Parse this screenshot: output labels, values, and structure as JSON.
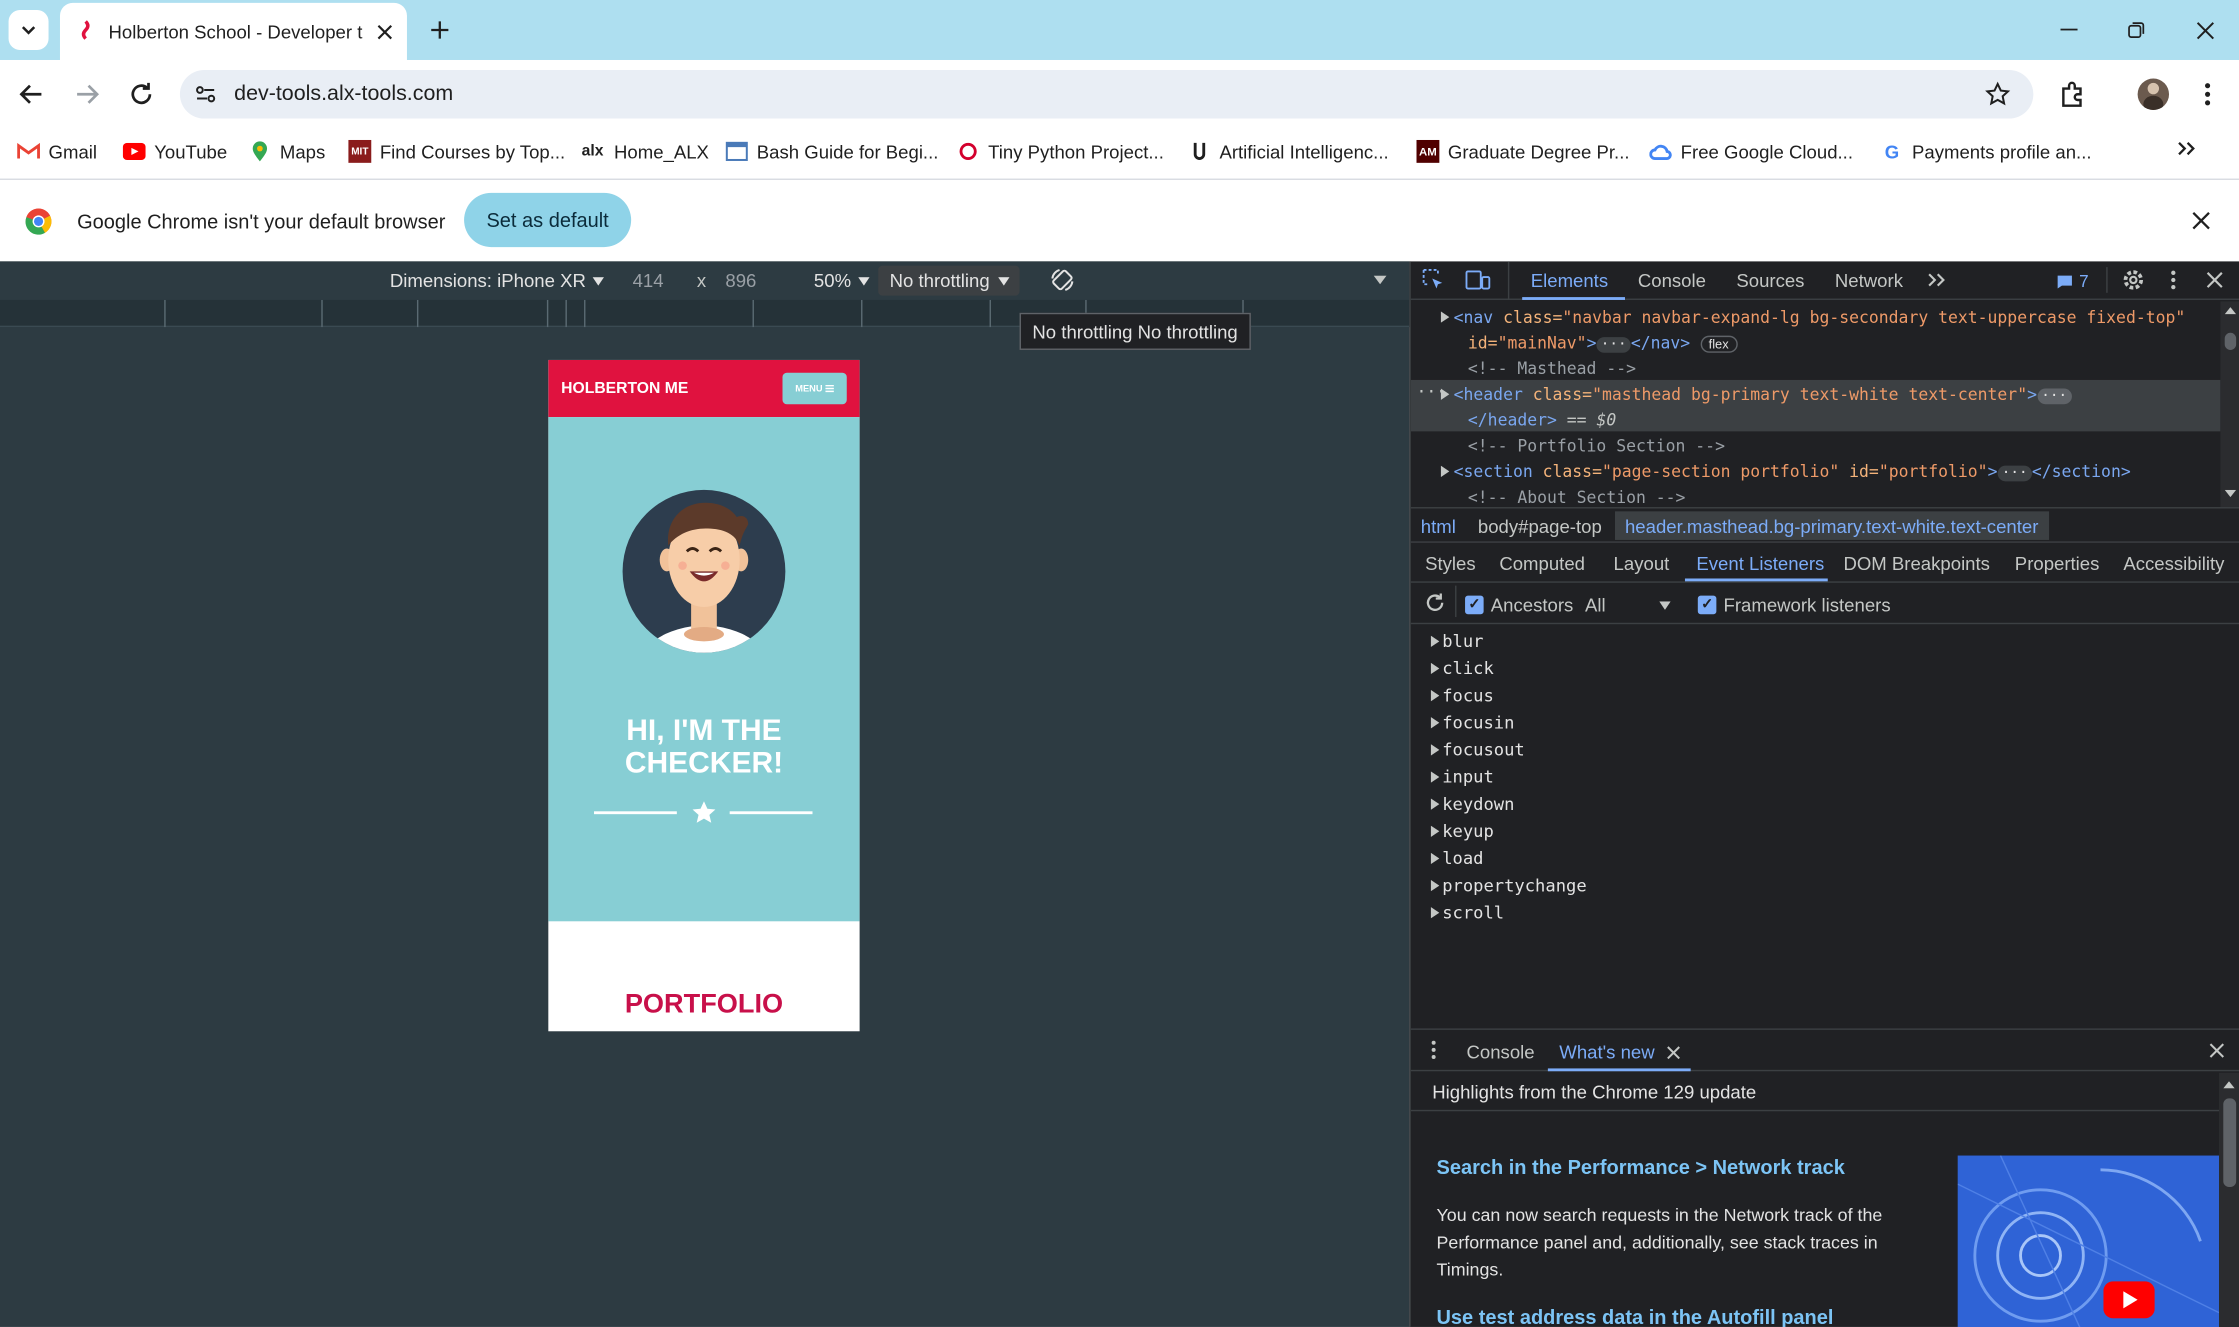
{
  "browser": {
    "tab_title": "Holberton School - Developer t",
    "url": "dev-tools.alx-tools.com",
    "bookmarks": [
      {
        "label": "Gmail",
        "icon": "gmail-icon"
      },
      {
        "label": "YouTube",
        "icon": "youtube-icon"
      },
      {
        "label": "Maps",
        "icon": "maps-icon"
      },
      {
        "label": "Find Courses by Top...",
        "icon": "mit-icon"
      },
      {
        "label": "Home_ALX",
        "icon": "alx-icon"
      },
      {
        "label": "Bash Guide for Begi...",
        "icon": "page-icon"
      },
      {
        "label": "Tiny Python Project...",
        "icon": "oreilly-icon"
      },
      {
        "label": "Artificial Intelligenc...",
        "icon": "udacity-icon"
      },
      {
        "label": "Graduate Degree Pr...",
        "icon": "tamu-icon"
      },
      {
        "label": "Free Google Cloud...",
        "icon": "gcloud-icon"
      },
      {
        "label": "Payments profile an...",
        "icon": "google-icon"
      }
    ],
    "infobar": {
      "message": "Google Chrome isn't your default browser",
      "button": "Set as default"
    }
  },
  "device_toolbar": {
    "dimensions": "Dimensions: iPhone XR",
    "width": "414",
    "times": "x",
    "height": "896",
    "zoom": "50%",
    "throttling": "No throttling",
    "tooltip": "No throttling No throttling"
  },
  "phone": {
    "brand": "HOLBERTON ME",
    "menu": "MENU",
    "hero_line1": "HI, I'M THE",
    "hero_line2": "CHECKER!",
    "section": "PORTFOLIO",
    "colors": {
      "nav": "#e0123f",
      "hero": "#87ced4",
      "accent": "#c8104a"
    }
  },
  "devtools": {
    "tabs": [
      "Elements",
      "Console",
      "Sources",
      "Network"
    ],
    "issues_count": "7",
    "dom": {
      "nav_tag": "<nav",
      "nav_attr1": "class=",
      "nav_val1": "\"navbar navbar-expand-lg bg-secondary text-uppercase fixed-top\"",
      "nav_attr2": "id=",
      "nav_val2": "\"mainNav\"",
      "nav_close": "</nav>",
      "flex_badge": "flex",
      "comment_masthead": "<!-- Masthead -->",
      "header_tag": "<header",
      "header_attr": "class=",
      "header_val": "\"masthead bg-primary text-white text-center\"",
      "header_close": "</header>",
      "header_ref": "== $0",
      "comment_portfolio": "<!-- Portfolio Section -->",
      "section_tag": "<section",
      "section_attr1": "class=",
      "section_val1": "\"page-section portfolio\"",
      "section_attr2": "id=",
      "section_val2": "\"portfolio\"",
      "section_close": "</section>",
      "comment_about": "<!-- About Section -->"
    },
    "breadcrumbs": [
      "html",
      "body#page-top",
      "header.masthead.bg-primary.text-white.text-center"
    ],
    "subtabs": [
      "Styles",
      "Computed",
      "Layout",
      "Event Listeners",
      "DOM Breakpoints",
      "Properties",
      "Accessibility"
    ],
    "filter": {
      "ancestors": "Ancestors",
      "all": "All",
      "framework": "Framework listeners"
    },
    "events": [
      "blur",
      "click",
      "focus",
      "focusin",
      "focusout",
      "input",
      "keydown",
      "keyup",
      "load",
      "propertychange",
      "scroll"
    ],
    "drawer": {
      "tabs": [
        "Console",
        "What's new"
      ],
      "highlight": "Highlights from the Chrome 129 update",
      "item1_title": "Search in the Performance > Network track",
      "item1_body": "You can now search requests in the Network track of the Performance panel and, additionally, see stack traces in Timings.",
      "item2_title": "Use test address data in the Autofill panel"
    }
  }
}
